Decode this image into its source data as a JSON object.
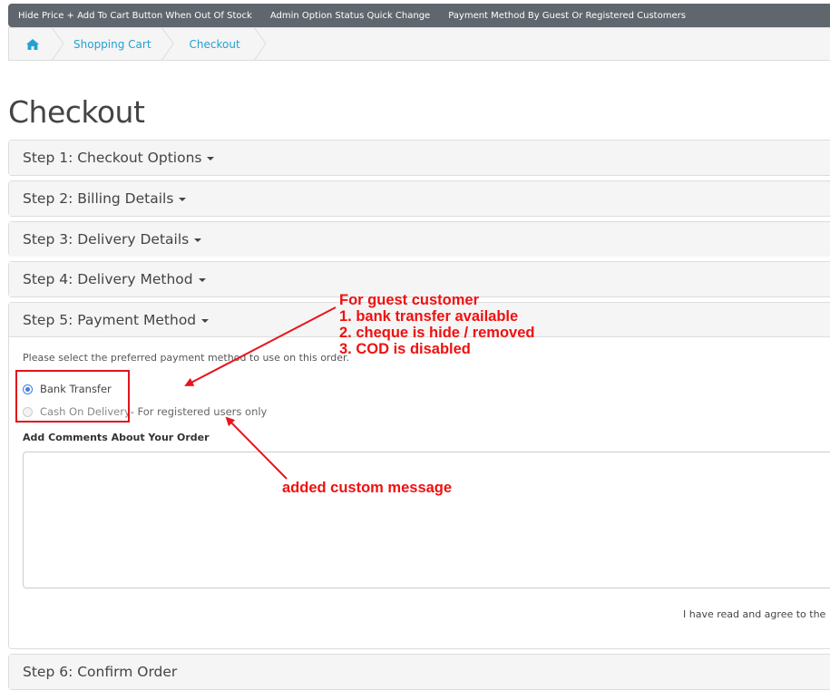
{
  "topnav": {
    "items": [
      "Hide Price + Add To Cart Button When Out Of Stock",
      "Admin Option Status Quick Change",
      "Payment Method By Guest Or Registered Customers"
    ]
  },
  "breadcrumb": {
    "home_icon": "home-icon",
    "items": [
      "Shopping Cart",
      "Checkout"
    ]
  },
  "page": {
    "title": "Checkout"
  },
  "steps": [
    "Step 1: Checkout Options",
    "Step 2: Billing Details",
    "Step 3: Delivery Details",
    "Step 4: Delivery Method",
    "Step 5: Payment Method",
    "Step 6: Confirm Order"
  ],
  "payment": {
    "instructions": "Please select the preferred payment method to use on this order.",
    "options": [
      {
        "label": "Bank Transfer",
        "checked": true,
        "disabled": false,
        "note": ""
      },
      {
        "label": "Cash On Delivery",
        "checked": false,
        "disabled": true,
        "note": " - For registered users only"
      }
    ],
    "comments_label": "Add Comments About Your Order",
    "comments_value": "",
    "agree_text": "I have read and agree to the"
  },
  "annotations": {
    "guest_lines": [
      "For guest customer",
      "1. bank transfer available",
      "2. cheque is hide / removed",
      "3. COD is disabled"
    ],
    "custom_message": "added custom message",
    "color": "#f01010"
  },
  "colors": {
    "link": "#23a1d1",
    "nav_bg": "#5f666d",
    "radio_checked": "#3b7fe6"
  }
}
